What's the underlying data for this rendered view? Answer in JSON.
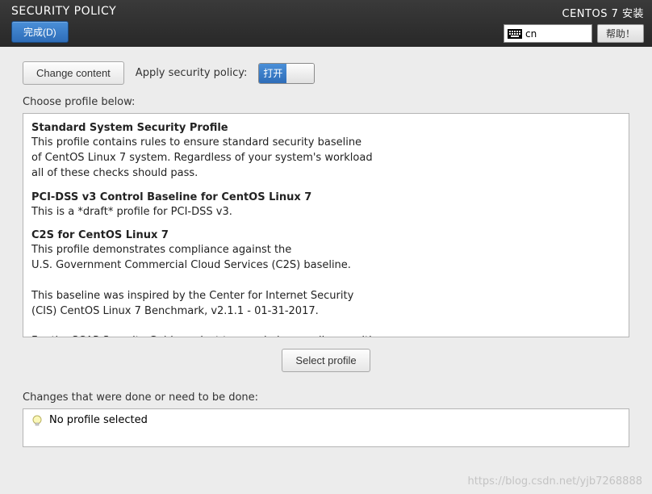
{
  "header": {
    "title": "SECURITY POLICY",
    "done_label": "完成(D)",
    "installer_title": "CENTOS 7 安装",
    "lang_code": "cn",
    "help_label": "帮助！"
  },
  "toolbar": {
    "change_content_label": "Change content",
    "apply_label": "Apply security policy:",
    "toggle_on_label": "打开"
  },
  "profiles": {
    "choose_label": "Choose profile below:",
    "items": [
      {
        "title": "Standard System Security Profile",
        "desc": "This profile contains rules to ensure standard security baseline\nof CentOS Linux 7 system. Regardless of your system's workload\nall of these checks should pass."
      },
      {
        "title": "PCI-DSS v3 Control Baseline for CentOS Linux 7",
        "desc": "This is a *draft* profile for PCI-DSS v3."
      },
      {
        "title": "C2S for CentOS Linux 7",
        "desc": "This profile demonstrates compliance against the\nU.S. Government Commercial Cloud Services (C2S) baseline.\n\nThis baseline was inspired by the Center for Internet Security\n(CIS) CentOS Linux 7 Benchmark, v2.1.1 - 01-31-2017.\n\nFor the SCAP Security Guide project to remain in compliance with"
      }
    ],
    "select_profile_label": "Select profile"
  },
  "changes": {
    "label": "Changes that were done or need to be done:",
    "status_text": "No profile selected"
  },
  "watermark": "https://blog.csdn.net/yjb7268888"
}
